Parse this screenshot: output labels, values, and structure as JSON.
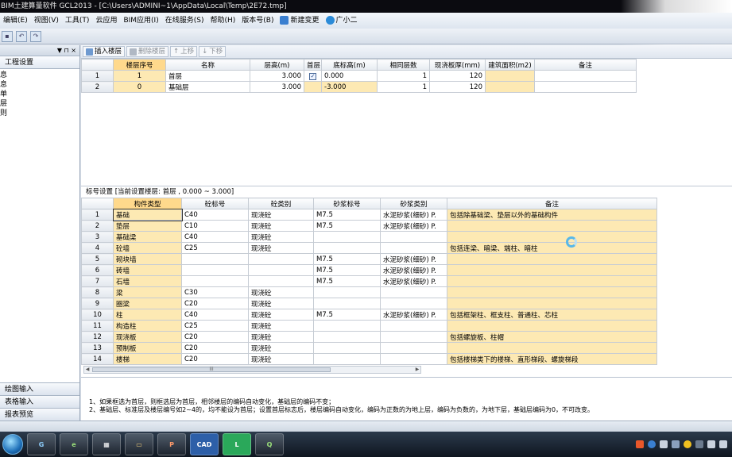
{
  "window": {
    "title": "BIM土建算量软件 GCL2013 - [C:\\Users\\ADMINI~1\\AppData\\Local\\Temp\\2E72.tmp]"
  },
  "menu": [
    {
      "label": "编辑(E)"
    },
    {
      "label": "视图(V)"
    },
    {
      "label": "工具(T)"
    },
    {
      "label": "云应用"
    },
    {
      "label": "BIM应用(I)"
    },
    {
      "label": "在线服务(S)"
    },
    {
      "label": "帮助(H)"
    },
    {
      "label": "版本号(B)"
    },
    {
      "label": "新建变更",
      "icon": "new-change-icon",
      "color": "#3a7fd0"
    },
    {
      "label": "广小二",
      "icon": "assistant-icon",
      "color": "#2b8bd8"
    }
  ],
  "left_panel": {
    "pin": "▼ ⊓ ×",
    "tab": "工程设置",
    "tree": [
      "息",
      "息",
      "单",
      "层",
      "则"
    ],
    "bottom_tabs": [
      "绘图输入",
      "表格输入",
      "报表预览"
    ]
  },
  "floor_toolbar": {
    "insert": "插入楼层",
    "delete": "删除楼层",
    "up": "上移",
    "down": "下移"
  },
  "floor_table": {
    "headers": [
      "",
      "楼层序号",
      "名称",
      "层高(m)",
      "首层",
      "底标高(m)",
      "相同层数",
      "现浇板厚(mm)",
      "建筑面积(m2)",
      "备注"
    ],
    "rows": [
      {
        "idx": "1",
        "seq": "1",
        "name": "首层",
        "height": "3.000",
        "first": true,
        "bottom": "0.000",
        "same": "1",
        "slab": "120",
        "area": "",
        "remark": ""
      },
      {
        "idx": "2",
        "seq": "0",
        "name": "基础层",
        "height": "3.000",
        "first": false,
        "bottom": "-3.000",
        "same": "1",
        "slab": "120",
        "area": "",
        "remark": ""
      }
    ]
  },
  "grade_label": "标号设置 [当前设置楼层: 首层 , 0.000 ~ 3.000]",
  "grade_table": {
    "headers": [
      "",
      "构件类型",
      "砼标号",
      "砼类别",
      "砂浆标号",
      "砂浆类别",
      "备注"
    ],
    "rows": [
      {
        "idx": "1",
        "type": "基础",
        "concrete": "C40",
        "ctype": "现浇砼",
        "mortar": "M7.5",
        "mtype": "水泥砂浆(细砂) P.",
        "remark": "包括除基础梁、垫层以外的基础构件"
      },
      {
        "idx": "2",
        "type": "垫层",
        "concrete": "C10",
        "ctype": "现浇砼",
        "mortar": "M7.5",
        "mtype": "水泥砂浆(细砂) P.",
        "remark": ""
      },
      {
        "idx": "3",
        "type": "基础梁",
        "concrete": "C40",
        "ctype": "现浇砼",
        "mortar": "",
        "mtype": "",
        "remark": ""
      },
      {
        "idx": "4",
        "type": "砼墙",
        "concrete": "C25",
        "ctype": "现浇砼",
        "mortar": "",
        "mtype": "",
        "remark": "包括连梁、暗梁、端柱、暗柱"
      },
      {
        "idx": "5",
        "type": "砌块墙",
        "concrete": "",
        "ctype": "",
        "mortar": "M7.5",
        "mtype": "水泥砂浆(细砂) P.",
        "remark": ""
      },
      {
        "idx": "6",
        "type": "砖墙",
        "concrete": "",
        "ctype": "",
        "mortar": "M7.5",
        "mtype": "水泥砂浆(细砂) P.",
        "remark": ""
      },
      {
        "idx": "7",
        "type": "石墙",
        "concrete": "",
        "ctype": "",
        "mortar": "M7.5",
        "mtype": "水泥砂浆(细砂) P.",
        "remark": ""
      },
      {
        "idx": "8",
        "type": "梁",
        "concrete": "C30",
        "ctype": "现浇砼",
        "mortar": "",
        "mtype": "",
        "remark": ""
      },
      {
        "idx": "9",
        "type": "圈梁",
        "concrete": "C20",
        "ctype": "现浇砼",
        "mortar": "",
        "mtype": "",
        "remark": ""
      },
      {
        "idx": "10",
        "type": "柱",
        "concrete": "C40",
        "ctype": "现浇砼",
        "mortar": "M7.5",
        "mtype": "水泥砂浆(细砂) P.",
        "remark": "包括框架柱、框支柱、普通柱、芯柱"
      },
      {
        "idx": "11",
        "type": "构造柱",
        "concrete": "C25",
        "ctype": "现浇砼",
        "mortar": "",
        "mtype": "",
        "remark": ""
      },
      {
        "idx": "12",
        "type": "现浇板",
        "concrete": "C20",
        "ctype": "现浇砼",
        "mortar": "",
        "mtype": "",
        "remark": "包括螺旋板、柱帽"
      },
      {
        "idx": "13",
        "type": "预制板",
        "concrete": "C20",
        "ctype": "现浇砼",
        "mortar": "",
        "mtype": "",
        "remark": ""
      },
      {
        "idx": "14",
        "type": "楼梯",
        "concrete": "C20",
        "ctype": "现浇砼",
        "mortar": "",
        "mtype": "",
        "remark": "包括楼梯类下的楼梯、直形梯段、螺旋梯段"
      }
    ]
  },
  "notes": [
    "1、如果框选为首层，则框选层为首层，相邻楼层的编码自动变化，基础层的编码不变；",
    "2、基础层、标准层及楼层编号如2~4的，均不能设为首层；设置首层标志后，楼层编码自动变化，编码为正数的为地上层，编码为负数的，为地下层，基础层编码为0，不可改变。"
  ],
  "taskbar": {
    "apps": [
      {
        "name": "glodon-app",
        "label": "G"
      },
      {
        "name": "browser-app",
        "label": "e"
      },
      {
        "name": "calculator-app",
        "label": "▦"
      },
      {
        "name": "explorer-app",
        "label": "▭"
      },
      {
        "name": "ppt-app",
        "label": "P"
      },
      {
        "name": "cad-app",
        "label": "CAD"
      },
      {
        "name": "gcl-app",
        "label": "L"
      },
      {
        "name": "gqi-app",
        "label": "Q"
      }
    ]
  },
  "colors": {
    "header_highlight": "#ffd98c",
    "cell_yellow": "#fde9b3",
    "accent_blue": "#3a7fd0"
  }
}
